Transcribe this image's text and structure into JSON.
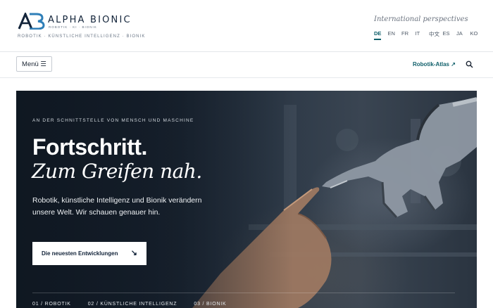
{
  "brand": {
    "logo_text": "AB",
    "name": "ALPHA BIONIC",
    "subline": "ROBOTIK · KI · BIONIK",
    "tagline": "ROBOTIK · KÜNSTLICHE INTELLIGENZ · BIONIK"
  },
  "header": {
    "intl_label": "International perspectives",
    "languages": [
      "DE",
      "EN",
      "FR",
      "IT",
      "中文",
      "ES",
      "JA",
      "KO"
    ],
    "active_language": "DE"
  },
  "nav": {
    "menu_label": "Menü ☰",
    "atlas_label": "Robotik-Atlas ↗",
    "search_icon": "search-icon"
  },
  "hero": {
    "eyebrow": "AN DER SCHNITTSTELLE VON MENSCH UND MASCHINE",
    "headline": "Fortschritt.",
    "headline_italic": "Zum Greifen nah.",
    "lead": "Robotik, künstliche Intelligenz und Bionik verändern unsere Welt. Wir schauen genauer hin.",
    "cta_label": "Die neuesten Entwicklungen",
    "cta_arrow": "↘",
    "tabs": [
      "01 / ROBOTIK",
      "02 / KÜNSTLICHE INTELLIGENZ",
      "03 / BIONIK"
    ]
  },
  "colors": {
    "accent": "#0f5f6a",
    "brand_navy": "#13243a"
  }
}
